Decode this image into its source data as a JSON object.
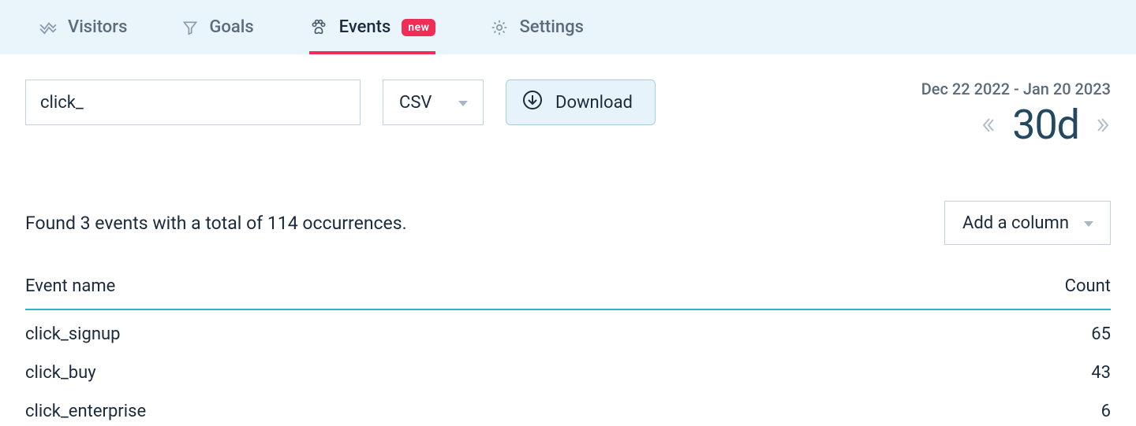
{
  "tabs": [
    {
      "label": "Visitors",
      "active": false
    },
    {
      "label": "Goals",
      "active": false
    },
    {
      "label": "Events",
      "active": true,
      "badge": "new"
    },
    {
      "label": "Settings",
      "active": false
    }
  ],
  "toolbar": {
    "search_value": "click_",
    "export_format": "CSV",
    "download_label": "Download"
  },
  "date_range": {
    "text": "Dec 22 2022 - Jan 20 2023",
    "period": "30d"
  },
  "summary": {
    "text": "Found 3 events with a total of 114 occurrences.",
    "add_column_label": "Add a column"
  },
  "table": {
    "headers": {
      "name": "Event name",
      "count": "Count"
    },
    "rows": [
      {
        "name": "click_signup",
        "count": "65"
      },
      {
        "name": "click_buy",
        "count": "43"
      },
      {
        "name": "click_enterprise",
        "count": "6"
      }
    ]
  }
}
